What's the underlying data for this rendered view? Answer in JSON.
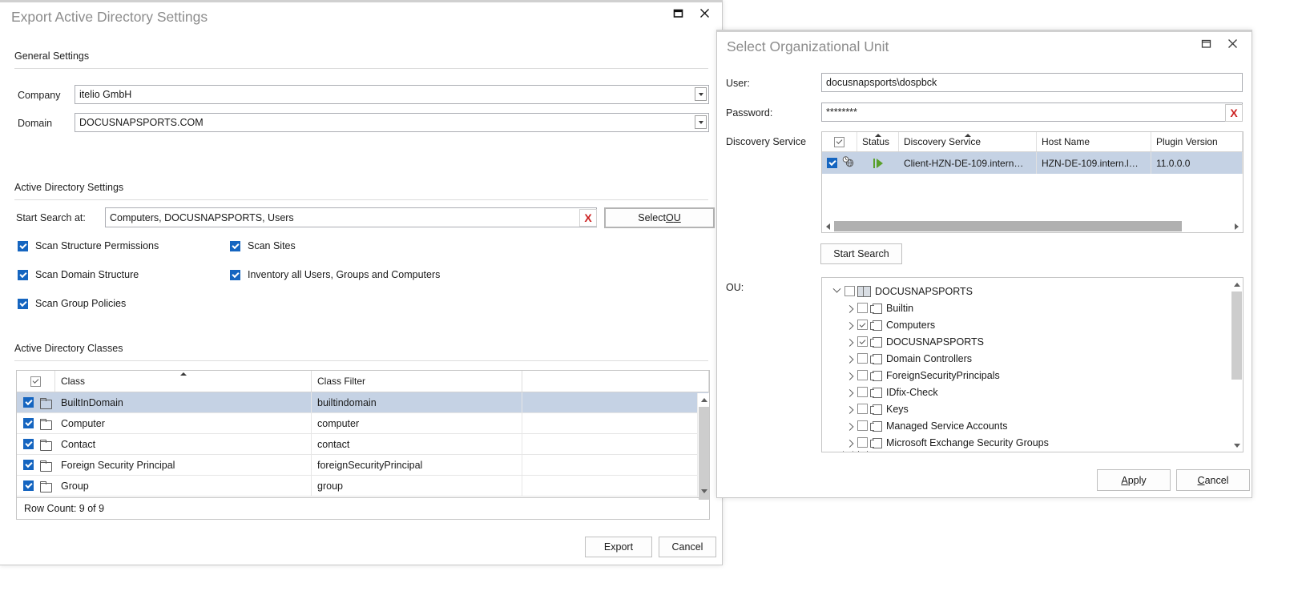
{
  "export_dialog": {
    "title": "Export Active Directory Settings",
    "controls": {
      "restore": "restore-icon",
      "close": "close-icon"
    },
    "general_settings": {
      "group_title": "General Settings",
      "company_label": "Company",
      "company_value": "itelio GmbH",
      "domain_label": "Domain",
      "domain_value": "DOCUSNAPSPORTS.COM"
    },
    "ad_settings": {
      "group_title": "Active Directory Settings",
      "start_search_label": "Start Search at:",
      "start_search_value": "Computers, DOCUSNAPSPORTS, Users",
      "clear_button": "X",
      "select_ou_button": {
        "pre": "Select ",
        "accel": "O",
        "post": "U"
      },
      "checkboxes": [
        {
          "label": "Scan Structure Permissions",
          "checked": true
        },
        {
          "label": "Scan Sites",
          "checked": true
        },
        {
          "label": "Scan Domain Structure",
          "checked": true
        },
        {
          "label": "Inventory all Users, Groups and Computers",
          "checked": true
        },
        {
          "label": "Scan Group Policies",
          "checked": true
        }
      ]
    },
    "ad_classes": {
      "group_title": "Active Directory Classes",
      "columns": [
        "",
        "Class",
        "Class Filter",
        ""
      ],
      "sorted_column": "Class",
      "sort_direction": "ascending",
      "header_checkbox": true,
      "rows": [
        {
          "checked": true,
          "class": "BuiltInDomain",
          "filter": "builtindomain",
          "selected": true
        },
        {
          "checked": true,
          "class": "Computer",
          "filter": "computer",
          "selected": false
        },
        {
          "checked": true,
          "class": "Contact",
          "filter": "contact",
          "selected": false
        },
        {
          "checked": true,
          "class": "Foreign Security Principal",
          "filter": "foreignSecurityPrincipal",
          "selected": false
        },
        {
          "checked": true,
          "class": "Group",
          "filter": "group",
          "selected": false
        }
      ],
      "row_count": "Row Count: 9 of 9"
    },
    "footer": {
      "export_label": "Export",
      "cancel_label": "Cancel"
    }
  },
  "ou_dialog": {
    "title": "Select Organizational Unit",
    "controls": {
      "restore": "restore-icon",
      "close": "close-icon"
    },
    "user_label": "User:",
    "user_value": "docusnapsports\\dospbck",
    "password_label": "Password:",
    "password_value": "********",
    "password_clear": "X",
    "discovery_label": "Discovery Service",
    "discovery_grid": {
      "columns": [
        "",
        "Status",
        "Discovery Service",
        "Host Name",
        "Plugin Version"
      ],
      "header_checkbox": true,
      "sorted_columns": [
        "Status",
        "Discovery Service"
      ],
      "rows": [
        {
          "checked": true,
          "type_icon": "globe-clock-icon",
          "status_icon": "running-icon",
          "discovery_service": "Client-HZN-DE-109.intern…",
          "host_name": "HZN-DE-109.intern.l…",
          "plugin_version": "11.0.0.0"
        }
      ]
    },
    "start_search_button": "Start Search",
    "ou_label": "OU:",
    "ou_tree": [
      {
        "label": "DOCUSNAPSPORTS",
        "depth": 0,
        "checked": false,
        "expanded": true,
        "icon": "domain-icon"
      },
      {
        "label": "Builtin",
        "depth": 1,
        "checked": false,
        "expanded": false,
        "icon": "ou-icon"
      },
      {
        "label": "Computers",
        "depth": 1,
        "checked": true,
        "expanded": false,
        "icon": "ou-icon"
      },
      {
        "label": "DOCUSNAPSPORTS",
        "depth": 1,
        "checked": true,
        "expanded": false,
        "icon": "ou-icon"
      },
      {
        "label": "Domain Controllers",
        "depth": 1,
        "checked": false,
        "expanded": false,
        "icon": "ou-icon"
      },
      {
        "label": "ForeignSecurityPrincipals",
        "depth": 1,
        "checked": false,
        "expanded": false,
        "icon": "ou-icon"
      },
      {
        "label": "IDfix-Check",
        "depth": 1,
        "checked": false,
        "expanded": false,
        "icon": "ou-icon"
      },
      {
        "label": "Keys",
        "depth": 1,
        "checked": false,
        "expanded": false,
        "icon": "ou-icon"
      },
      {
        "label": "Managed Service Accounts",
        "depth": 1,
        "checked": false,
        "expanded": false,
        "icon": "ou-icon"
      },
      {
        "label": "Microsoft Exchange Security Groups",
        "depth": 1,
        "checked": false,
        "expanded": false,
        "icon": "ou-icon"
      }
    ],
    "footer": {
      "apply": {
        "pre": "",
        "accel": "A",
        "post": "pply"
      },
      "cancel": {
        "pre": "",
        "accel": "C",
        "post": "ancel"
      }
    }
  },
  "colors": {
    "accent_checkbox": "#1565c0",
    "selection_row": "#c5d2e4",
    "title_text": "#8c8c8c",
    "clear_x": "#cc2222",
    "status_running": "#5aa02c"
  }
}
